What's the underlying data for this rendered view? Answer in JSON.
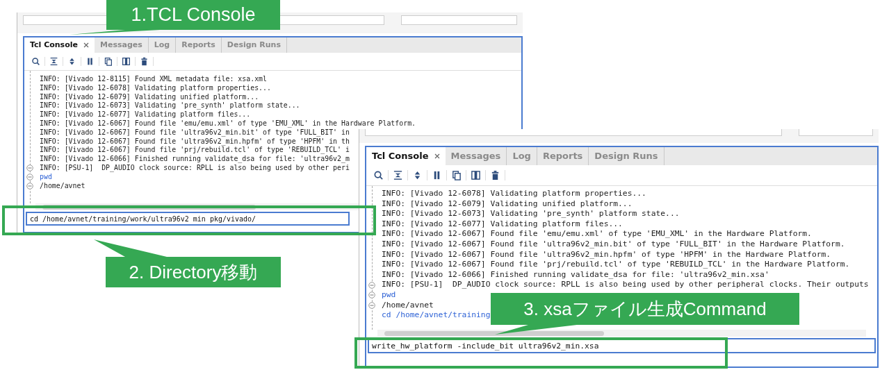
{
  "consoles": [
    {
      "tabs": [
        {
          "label": "Tcl Console",
          "selected": true,
          "closable": true
        },
        {
          "label": "Messages",
          "selected": false,
          "closable": false
        },
        {
          "label": "Log",
          "selected": false,
          "closable": false
        },
        {
          "label": "Reports",
          "selected": false,
          "closable": false
        },
        {
          "label": "Design Runs",
          "selected": false,
          "closable": false
        }
      ],
      "lines": [
        {
          "text": "INFO: [Vivado 12-8115] Found XML metadata file: xsa.xml",
          "kind": "info",
          "collapsible": false
        },
        {
          "text": "INFO: [Vivado 12-6078] Validating platform properties...",
          "kind": "info",
          "collapsible": false
        },
        {
          "text": "INFO: [Vivado 12-6079] Validating unified platform...",
          "kind": "info",
          "collapsible": false
        },
        {
          "text": "INFO: [Vivado 12-6073] Validating 'pre_synth' platform state...",
          "kind": "info",
          "collapsible": false
        },
        {
          "text": "INFO: [Vivado 12-6077] Validating platform files...",
          "kind": "info",
          "collapsible": false
        },
        {
          "text": "INFO: [Vivado 12-6067] Found file 'emu/emu.xml' of type 'EMU_XML' in the Hardware Platform.",
          "kind": "info",
          "collapsible": false
        },
        {
          "text": "INFO: [Vivado 12-6067] Found file 'ultra96v2_min.bit' of type 'FULL_BIT' in",
          "kind": "info",
          "collapsible": false
        },
        {
          "text": "INFO: [Vivado 12-6067] Found file 'ultra96v2_min.hpfm' of type 'HPFM' in th",
          "kind": "info",
          "collapsible": false
        },
        {
          "text": "INFO: [Vivado 12-6067] Found file 'prj/rebuild.tcl' of type 'REBUILD_TCL' i",
          "kind": "info",
          "collapsible": false
        },
        {
          "text": "INFO: [Vivado 12-6066] Finished running validate_dsa for file: 'ultra96v2_m",
          "kind": "info",
          "collapsible": false
        },
        {
          "text": "INFO: [PSU-1]  DP_AUDIO clock source: RPLL is also being used by other peri",
          "kind": "info",
          "collapsible": true
        },
        {
          "text": "pwd",
          "kind": "command",
          "collapsible": true
        },
        {
          "text": "/home/avnet",
          "kind": "output",
          "collapsible": true
        }
      ],
      "input": "cd /home/avnet/training/work/ultra96v2_min_pkg/vivado/"
    },
    {
      "tabs": [
        {
          "label": "Tcl Console",
          "selected": true,
          "closable": true
        },
        {
          "label": "Messages",
          "selected": false,
          "closable": false
        },
        {
          "label": "Log",
          "selected": false,
          "closable": false
        },
        {
          "label": "Reports",
          "selected": false,
          "closable": false
        },
        {
          "label": "Design Runs",
          "selected": false,
          "closable": false
        }
      ],
      "lines": [
        {
          "text": "INFO: [Vivado 12-6078] Validating platform properties...",
          "kind": "info",
          "collapsible": false
        },
        {
          "text": "INFO: [Vivado 12-6079] Validating unified platform...",
          "kind": "info",
          "collapsible": false
        },
        {
          "text": "INFO: [Vivado 12-6073] Validating 'pre_synth' platform state...",
          "kind": "info",
          "collapsible": false
        },
        {
          "text": "INFO: [Vivado 12-6077] Validating platform files...",
          "kind": "info",
          "collapsible": false
        },
        {
          "text": "INFO: [Vivado 12-6067] Found file 'emu/emu.xml' of type 'EMU_XML' in the Hardware Platform.",
          "kind": "info",
          "collapsible": false
        },
        {
          "text": "INFO: [Vivado 12-6067] Found file 'ultra96v2_min.bit' of type 'FULL_BIT' in the Hardware Platform.",
          "kind": "info",
          "collapsible": false
        },
        {
          "text": "INFO: [Vivado 12-6067] Found file 'ultra96v2_min.hpfm' of type 'HPFM' in the Hardware Platform.",
          "kind": "info",
          "collapsible": false
        },
        {
          "text": "INFO: [Vivado 12-6067] Found file 'prj/rebuild.tcl' of type 'REBUILD_TCL' in the Hardware Platform.",
          "kind": "info",
          "collapsible": false
        },
        {
          "text": "INFO: [Vivado 12-6066] Finished running validate_dsa for file: 'ultra96v2_min.xsa'",
          "kind": "info",
          "collapsible": false
        },
        {
          "text": "INFO: [PSU-1]  DP_AUDIO clock source: RPLL is also being used by other peripheral clocks. Their outputs",
          "kind": "info",
          "collapsible": true
        },
        {
          "text": "pwd",
          "kind": "command",
          "collapsible": true
        },
        {
          "text": "/home/avnet",
          "kind": "output",
          "collapsible": true
        },
        {
          "text": "cd /home/avnet/training",
          "kind": "command",
          "collapsible": false
        }
      ],
      "input": "write_hw_platform -include_bit ultra96v2_min.xsa"
    }
  ],
  "callouts": [
    {
      "text": "1.TCL Console"
    },
    {
      "text": "2. Directory移動"
    },
    {
      "text": "3. xsaファイル生成Command"
    }
  ]
}
